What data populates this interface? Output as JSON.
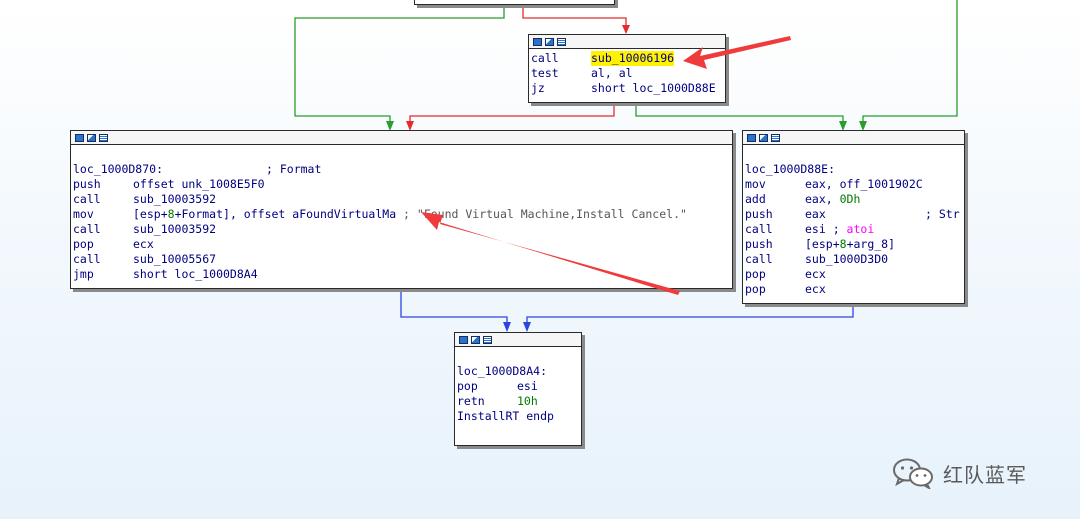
{
  "graph": {
    "top_block": {
      "icons": [
        "graph-view-icon",
        "flow-view-icon",
        "text-view-icon"
      ],
      "lines": [
        {
          "mnemonic": "call",
          "operand": "sub_10006196"
        },
        {
          "mnemonic": "test",
          "operand": "al, al"
        },
        {
          "mnemonic": "jz",
          "operand": "short loc_1000D88E"
        }
      ]
    },
    "left_block": {
      "label": "loc_1000D870:",
      "label_comment": "; Format",
      "lines": [
        {
          "mnemonic": "push",
          "operand": "offset unk_1008E5F0"
        },
        {
          "mnemonic": "call",
          "operand": "sub_10003592"
        },
        {
          "mnemonic": "mov",
          "operand_open": "[esp+",
          "operand_num": "8",
          "operand_plus": "+Format",
          "operand_close": "], offset aFoundVirtualMa",
          "comment": " ; \"Found Virtual Machine,Install Cancel.\""
        },
        {
          "mnemonic": "call",
          "operand": "sub_10003592"
        },
        {
          "mnemonic": "pop",
          "operand": "ecx"
        },
        {
          "mnemonic": "call",
          "operand": "sub_10005567"
        },
        {
          "mnemonic": "jmp",
          "operand": "short loc_1000D8A4"
        }
      ]
    },
    "right_block": {
      "label": "loc_1000D88E:",
      "lines": [
        {
          "mnemonic": "mov",
          "operand": "eax, off_1001902C"
        },
        {
          "mnemonic": "add",
          "operand": "eax, ",
          "operand_num": "0Dh"
        },
        {
          "mnemonic": "push",
          "operand": "eax",
          "comment": "; Str"
        },
        {
          "mnemonic": "call",
          "operand": "esi ; ",
          "operand_ext": "atoi"
        },
        {
          "mnemonic": "push",
          "operand_open": "[esp+",
          "operand_num": "8",
          "operand_close": "+arg_8]"
        },
        {
          "mnemonic": "call",
          "operand": "sub_1000D3D0"
        },
        {
          "mnemonic": "pop",
          "operand": "ecx"
        },
        {
          "mnemonic": "pop",
          "operand": "ecx"
        }
      ]
    },
    "bottom_block": {
      "label": "loc_1000D8A4:",
      "lines": [
        {
          "mnemonic": "pop",
          "operand": "esi"
        },
        {
          "mnemonic": "retn",
          "operand_num": "10h"
        }
      ],
      "endp": "InstallRT endp"
    }
  },
  "colors": {
    "edge_true": "#2a9d2a",
    "edge_false": "#e52b2b",
    "edge_uncond": "#2c45e0",
    "annotation_arrow": "#ef3b3b",
    "highlight": "#fff200"
  },
  "watermark": {
    "icon": "wechat-icon",
    "text": "红队蓝军"
  }
}
